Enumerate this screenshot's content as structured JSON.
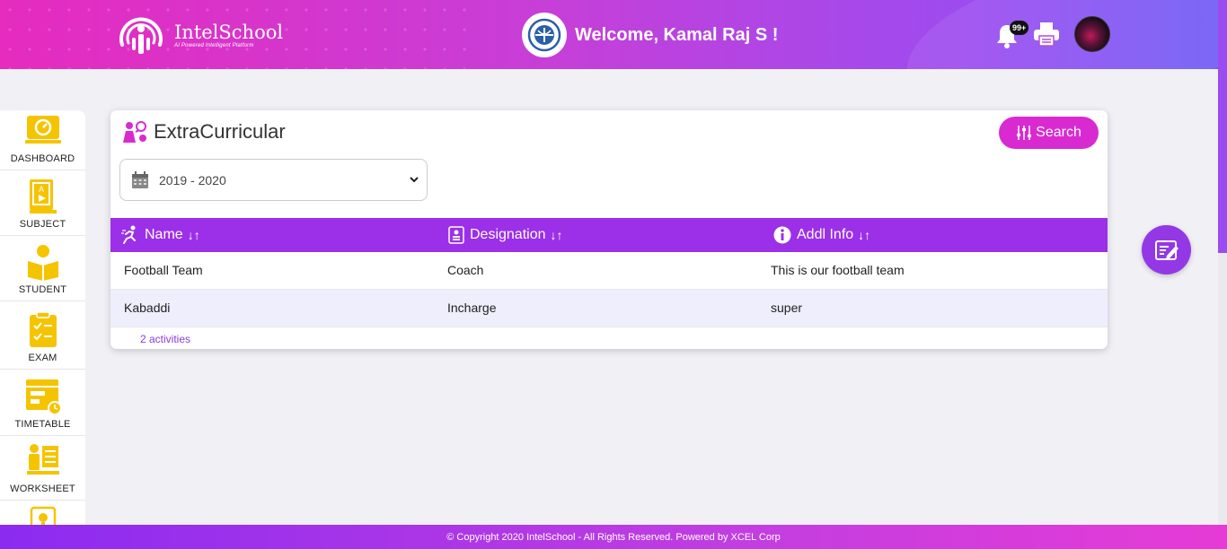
{
  "header": {
    "brand": "IntelSchool",
    "tagline": "AI Powered Intelligent Platform",
    "welcome": "Welcome, Kamal Raj S !",
    "notification_badge": "99+",
    "icons": [
      "bell-icon",
      "printer-icon",
      "avatar"
    ]
  },
  "sidebar": {
    "items": [
      {
        "label": "DASHBOARD",
        "icon": "dashboard-icon"
      },
      {
        "label": "SUBJECT",
        "icon": "subject-book-icon"
      },
      {
        "label": "STUDENT",
        "icon": "student-icon"
      },
      {
        "label": "EXAM",
        "icon": "exam-checklist-icon"
      },
      {
        "label": "TIMETABLE",
        "icon": "timetable-icon"
      },
      {
        "label": "WORKSHEET",
        "icon": "worksheet-icon"
      }
    ]
  },
  "page": {
    "title": "ExtraCurricular",
    "search_label": "Search",
    "year_select": {
      "value": "2019 - 2020"
    },
    "columns": [
      {
        "label": "Name",
        "icon": "runner-icon"
      },
      {
        "label": "Designation",
        "icon": "id-badge-icon"
      },
      {
        "label": "Addl Info",
        "icon": "info-icon"
      }
    ],
    "rows": [
      {
        "name": "Football Team",
        "designation": "Coach",
        "info": "This is our football team"
      },
      {
        "name": "Kabaddi",
        "designation": "Incharge",
        "info": "super"
      }
    ],
    "count_text": "2 activities"
  },
  "footer": {
    "copyright": "© Copyright 2020 IntelSchool - All Rights Reserved. Powered by XCEL Corp"
  },
  "colors": {
    "header_start": "#e62bbf",
    "header_end": "#6f5cf6",
    "table_header": "#9b30e8",
    "search_button": "#d92ad1",
    "sidebar_icon": "#f5c400",
    "fab": "#9438e6"
  }
}
